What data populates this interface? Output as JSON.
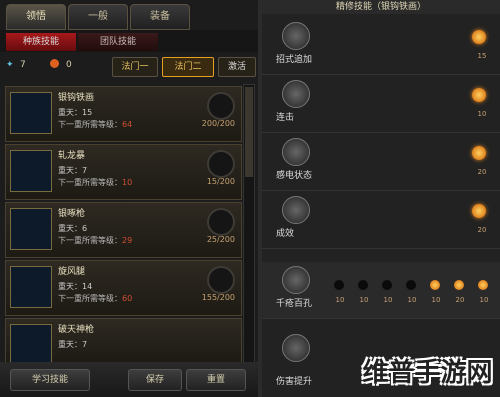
{
  "tabs": [
    "领悟",
    "一般",
    "装备"
  ],
  "subtabs": [
    "种族技能",
    "团队技能"
  ],
  "stats": {
    "gems": "7",
    "coins": "0"
  },
  "modes": [
    "法门一",
    "法门二",
    "激活"
  ],
  "skills": [
    {
      "name": "银钩铁画",
      "level": "重天：15",
      "req": "下一重所需等级：",
      "req_val": "64",
      "points": "200/200"
    },
    {
      "name": "轧龙暴",
      "level": "重天：7",
      "req": "下一重所需等级：",
      "req_val": "10",
      "points": "15/200"
    },
    {
      "name": "银啄枪",
      "level": "重天：6",
      "req": "下一重所需等级：",
      "req_val": "29",
      "points": "25/200"
    },
    {
      "name": "旋风腿",
      "level": "重天：14",
      "req": "下一重所需等级：",
      "req_val": "60",
      "points": "155/200"
    },
    {
      "name": "破天神枪",
      "level": "重天：7",
      "req": "",
      "req_val": "",
      "points": ""
    }
  ],
  "bottom_buttons": [
    "学习技能",
    "保存",
    "重置"
  ],
  "right": {
    "title": "精修技能（银钩铁画）",
    "rows": [
      {
        "label": "招式追加",
        "value": "15"
      },
      {
        "label": "连击",
        "value": "10"
      },
      {
        "label": "感电状态",
        "value": "20"
      },
      {
        "label": "成效",
        "value": "20"
      },
      {
        "label": "千疮百孔",
        "value": "",
        "dots": [
          "10",
          "10",
          "10",
          "10",
          "10",
          "20",
          "10"
        ]
      },
      {
        "label": "伤害提升",
        "value": ""
      }
    ]
  },
  "watermark": "维普手游网",
  "colors": {
    "accent_red": "#a8181b",
    "gold": "#e8a020",
    "bg": "#1a1a1a"
  }
}
